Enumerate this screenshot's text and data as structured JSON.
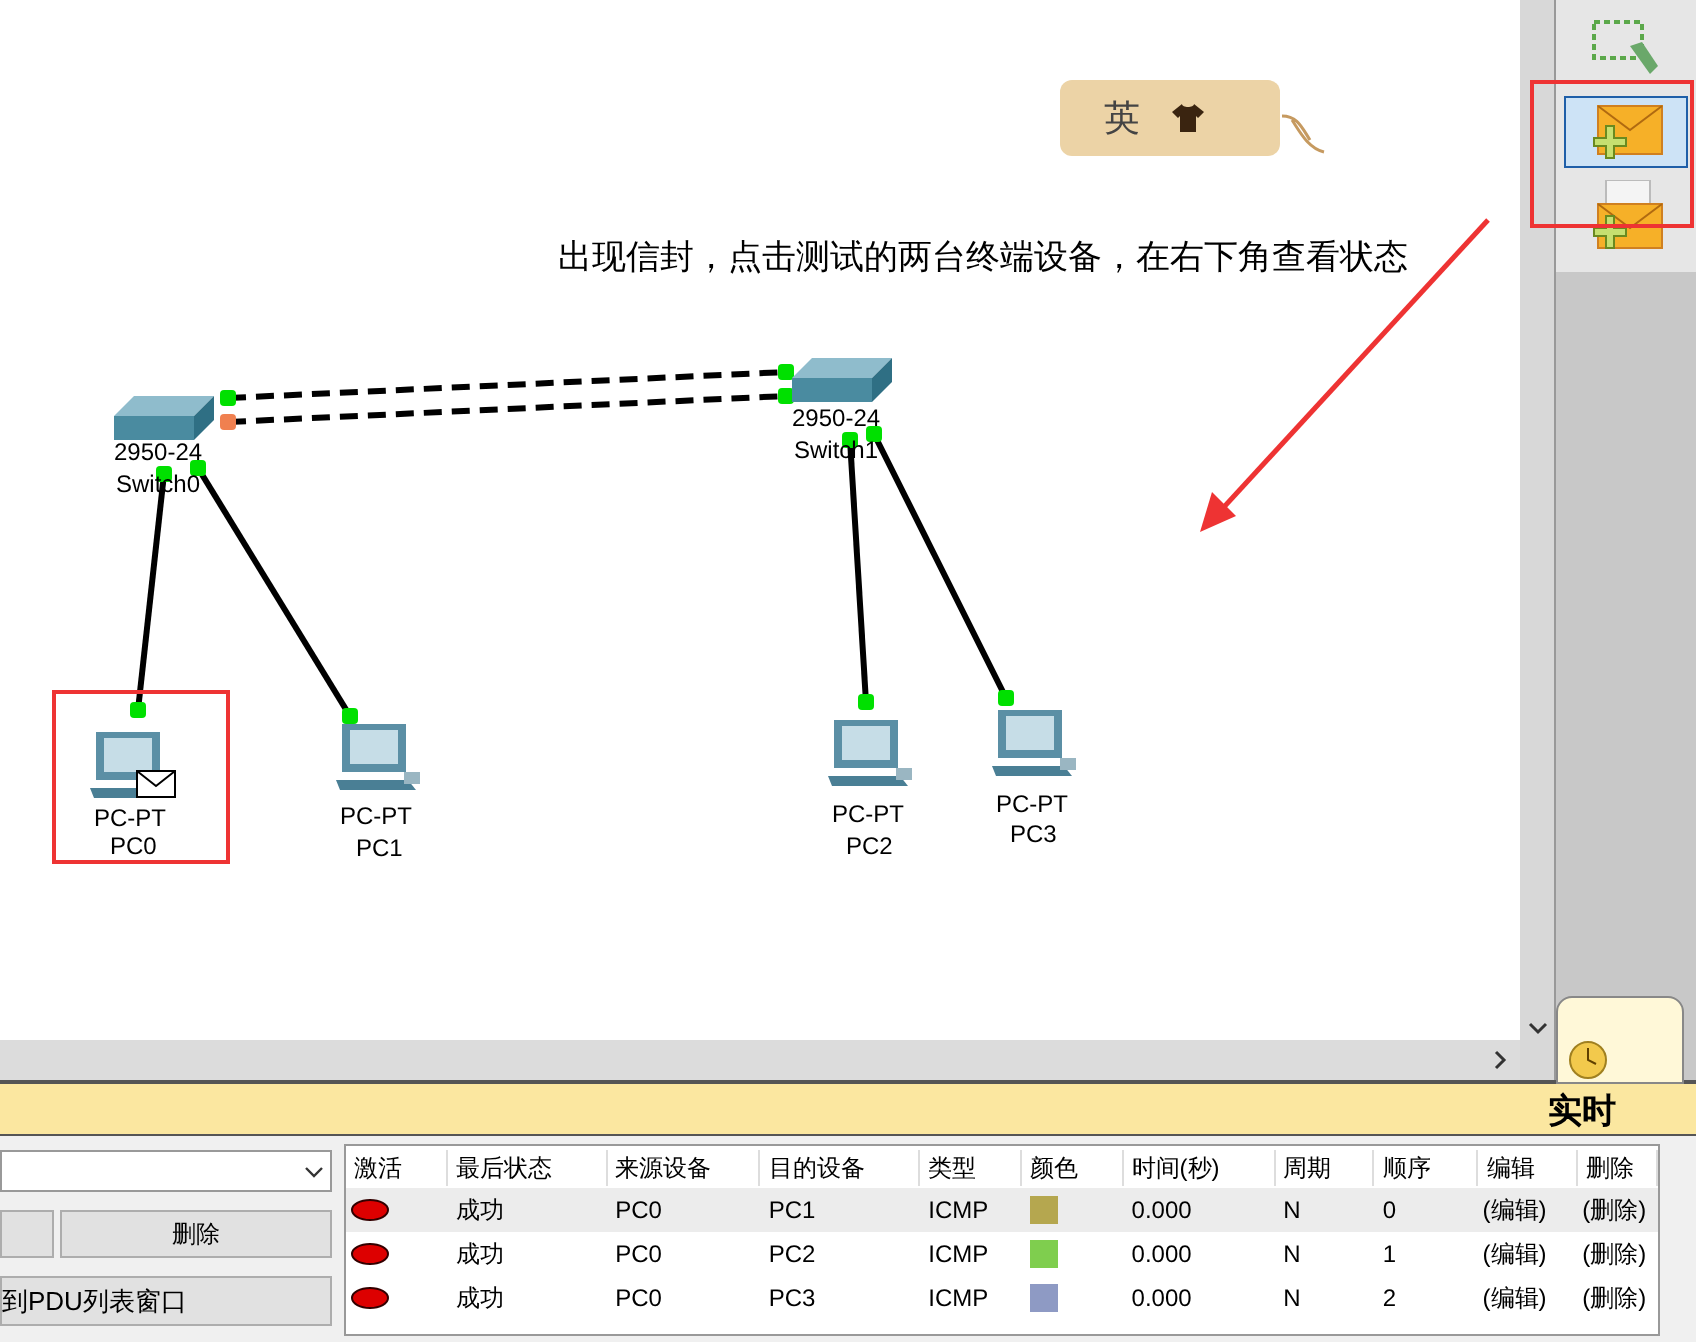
{
  "canvas": {
    "ime_tag": {
      "label": "英"
    },
    "note": "出现信封，点击测试的两台终端设备，在右下角查看状态",
    "devices": [
      {
        "kind": "switch",
        "model": "2950-24",
        "name": "Switch0",
        "pdu": false
      },
      {
        "kind": "switch",
        "model": "2950-24",
        "name": "Switch1",
        "pdu": false
      },
      {
        "kind": "pc",
        "model": "PC-PT",
        "name": "PC0",
        "pdu": true
      },
      {
        "kind": "pc",
        "model": "PC-PT",
        "name": "PC1",
        "pdu": false
      },
      {
        "kind": "pc",
        "model": "PC-PT",
        "name": "PC2",
        "pdu": false
      },
      {
        "kind": "pc",
        "model": "PC-PT",
        "name": "PC3",
        "pdu": false
      }
    ]
  },
  "toolbar": {
    "tools": [
      {
        "kind": "select",
        "selected": false
      },
      {
        "kind": "simple_pdu",
        "selected": true
      },
      {
        "kind": "complex_pdu",
        "selected": false
      }
    ]
  },
  "mode_bar": {
    "mode": "实时"
  },
  "scenario_panel": {
    "delete_button": "删除",
    "toggle_button": "到PDU列表窗口"
  },
  "pdu_table": {
    "columns": [
      "激活",
      "最后状态",
      "来源设备",
      "目的设备",
      "类型",
      "颜色",
      "时间(秒)",
      "周期",
      "顺序",
      "编辑",
      "删除"
    ],
    "rows": [
      {
        "status": "成功",
        "source": "PC0",
        "destination": "PC1",
        "type": "ICMP",
        "color": "#b5a74f",
        "time": "0.000",
        "periodic": "N",
        "num": "0",
        "edit": "(编辑)",
        "delete": "(删除)",
        "selected": true
      },
      {
        "status": "成功",
        "source": "PC0",
        "destination": "PC2",
        "type": "ICMP",
        "color": "#7fce4e",
        "time": "0.000",
        "periodic": "N",
        "num": "1",
        "edit": "(编辑)",
        "delete": "(删除)",
        "selected": false
      },
      {
        "status": "成功",
        "source": "PC0",
        "destination": "PC3",
        "type": "ICMP",
        "color": "#8e9ac4",
        "time": "0.000",
        "periodic": "N",
        "num": "2",
        "edit": "(编辑)",
        "delete": "(删除)",
        "selected": false
      }
    ]
  }
}
